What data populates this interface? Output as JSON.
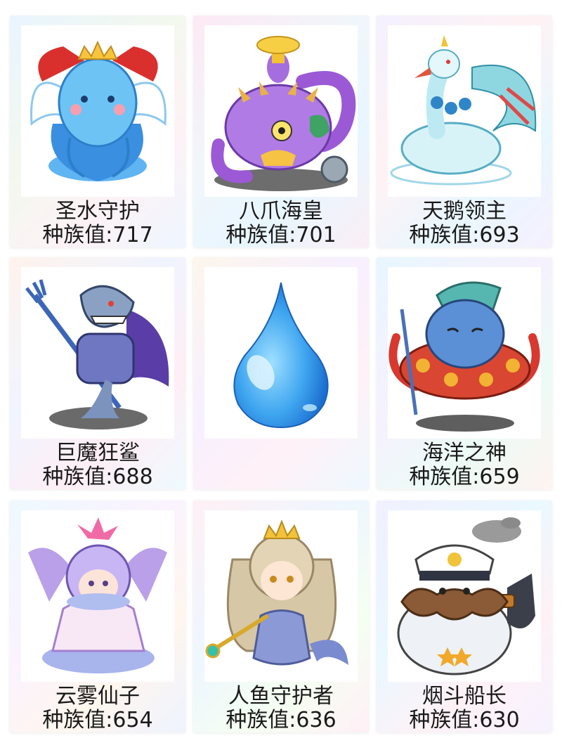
{
  "cards": [
    {
      "name": "圣水守护",
      "value": "种族值:717",
      "image": "blue-jellyfish-angel-crown-illustration"
    },
    {
      "name": "八爪海皇",
      "value": "种族值:701",
      "image": "purple-octopus-king-illustration"
    },
    {
      "name": "天鹅领主",
      "value": "种族值:693",
      "image": "teal-swan-lord-illustration"
    },
    {
      "name": "巨魔狂鲨",
      "value": "种族值:688",
      "image": "shark-warrior-trident-illustration"
    },
    {
      "name": "",
      "value": "",
      "image": "water-drop-illustration"
    },
    {
      "name": "海洋之神",
      "value": "种族值:659",
      "image": "fish-god-trident-illustration"
    },
    {
      "name": "云雾仙子",
      "value": "种族值:654",
      "image": "cloud-fairy-illustration"
    },
    {
      "name": "人鱼守护者",
      "value": "种族值:636",
      "image": "mermaid-princess-illustration"
    },
    {
      "name": "烟斗船长",
      "value": "种族值:630",
      "image": "pipe-captain-seal-illustration"
    }
  ]
}
